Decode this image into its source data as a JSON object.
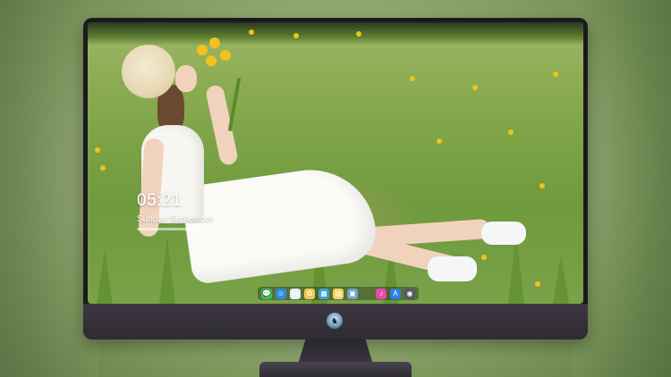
{
  "lockscreen": {
    "time": "05:21",
    "date": "Sunday September"
  },
  "dock": {
    "items": [
      {
        "name": "messages-icon",
        "color": "#34c759",
        "glyph": "💬"
      },
      {
        "name": "finder-icon",
        "color": "#2e8be0",
        "glyph": "☺"
      },
      {
        "name": "safari-icon",
        "color": "#e9eef2",
        "glyph": "◎"
      },
      {
        "name": "photos-icon",
        "color": "#f2c94c",
        "glyph": "✿"
      },
      {
        "name": "clapper-icon",
        "color": "#3aa0d8",
        "glyph": "▦"
      },
      {
        "name": "notes-icon",
        "color": "#f7d35c",
        "glyph": "▤"
      },
      {
        "name": "preview-icon",
        "color": "#6ba6c9",
        "glyph": "▣"
      },
      {
        "name": "itunes-icon",
        "color": "#e84aa8",
        "glyph": "♪"
      },
      {
        "name": "appstore-icon",
        "color": "#2f7fe8",
        "glyph": "A"
      },
      {
        "name": "camera-icon",
        "color": "#555a60",
        "glyph": "◉"
      }
    ]
  },
  "colors": {
    "monitor_frame": "#1a1a1e",
    "monitor_chin": "#3b3640",
    "text": "#ffffff"
  }
}
